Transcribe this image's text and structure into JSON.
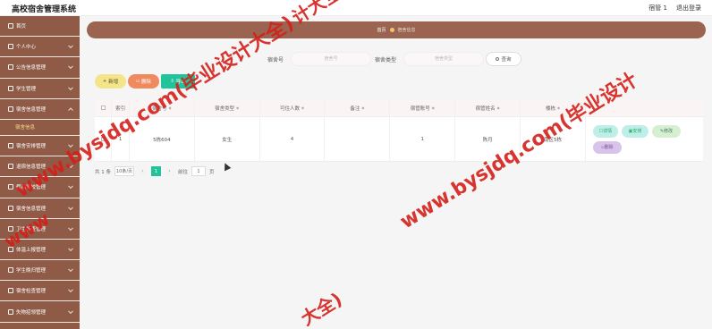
{
  "app": {
    "title": "高校宿舍管理系统",
    "user_role": "宿管",
    "user_name": "1",
    "logout": "退出登录"
  },
  "sidebar": {
    "items": [
      {
        "label": "首页"
      },
      {
        "label": "个人中心"
      },
      {
        "label": "公告信息管理"
      },
      {
        "label": "学生管理"
      },
      {
        "label": "宿舍信息管理"
      },
      {
        "label": "宿舍安排管理"
      },
      {
        "label": "退宿信息管理"
      },
      {
        "label": "假期留校管理"
      },
      {
        "label": "宿舍信息管理"
      },
      {
        "label": "卫生检查管理"
      },
      {
        "label": "体温上报管理"
      },
      {
        "label": "学生晚归管理"
      },
      {
        "label": "宿舍检查管理"
      },
      {
        "label": "失物招领管理"
      }
    ],
    "sub_item": "宿舍信息"
  },
  "breadcrumb": {
    "home": "首页",
    "current": "宿舍信息"
  },
  "search": {
    "label1": "宿舍号",
    "placeholder1": "宿舍号",
    "label2": "宿舍类型",
    "placeholder2": "宿舍类型",
    "button": "查询"
  },
  "actions": {
    "add": "新增",
    "delete": "删除",
    "export": "导出"
  },
  "table": {
    "headers": [
      "索引",
      "宿舍号",
      "宿舍类型",
      "可住人数",
      "备注",
      "宿管账号",
      "宿管姓名",
      "楼栋"
    ],
    "rows": [
      [
        "1",
        "5栋604",
        "女生",
        "4",
        "",
        "1",
        "陈月",
        "南区5栋"
      ]
    ],
    "ops": {
      "detail": "详情",
      "arrange": "安排",
      "edit": "修改",
      "delete": "删除"
    }
  },
  "pager": {
    "total": "共 1 条",
    "size": "10条/页",
    "current": "1",
    "goto": "前往",
    "goto_value": "1",
    "page_unit": "页"
  },
  "watermarks": {
    "site": "www.bysjdq.com(毕业设计大全)",
    "site2": "www.bysjdq.com(毕业设计",
    "frag1": "www",
    "frag2": "计大全)",
    "frag3": "大全)"
  },
  "colors": {
    "sidebar": "#8f5b47",
    "accent": "#20c39a",
    "watermark": "#d4201a"
  }
}
